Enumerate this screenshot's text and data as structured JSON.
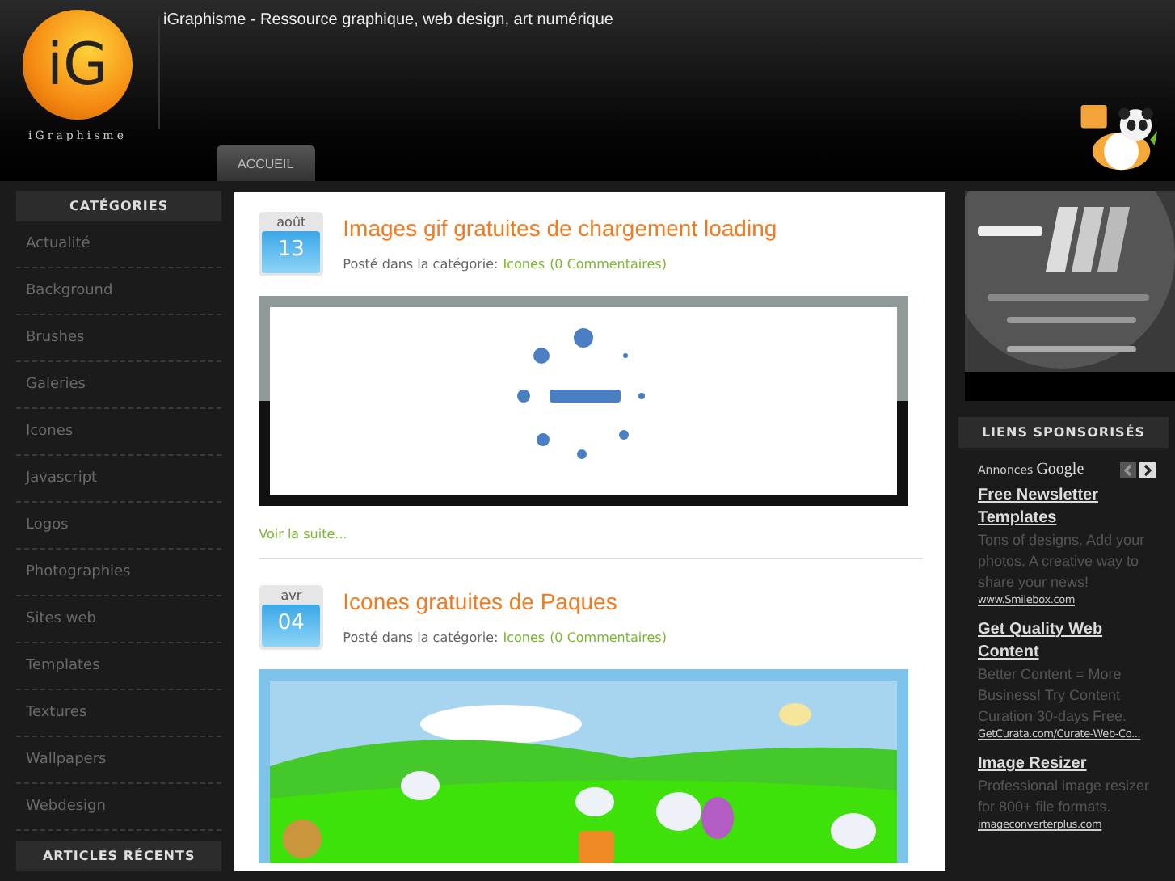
{
  "header": {
    "logo_mark": "iG",
    "logo_name": "iGraphisme",
    "tagline": "iGraphisme - Ressource graphique, web design, art numérique"
  },
  "nav": [
    {
      "label": "ACCUEIL",
      "selected": true
    }
  ],
  "sidebar": {
    "categories_title": "CATÉGORIES",
    "categories": [
      "Actualité",
      "Background",
      "Brushes",
      "Galeries",
      "Icones",
      "Javascript",
      "Logos",
      "Photographies",
      "Sites web",
      "Templates",
      "Textures",
      "Wallpapers",
      "Webdesign"
    ],
    "recent_title": "ARTICLES RÉCENTS"
  },
  "posts": [
    {
      "month": "août",
      "day": "13",
      "title": "Images gif gratuites de chargement loading",
      "meta_prefix": "Posté dans la catégorie:",
      "category": "Icones",
      "comments": "(0 Commentaires)",
      "more": "Voir la suite..."
    },
    {
      "month": "avr",
      "day": "04",
      "title": "Icones gratuites de Paques",
      "meta_prefix": "Posté dans la catégorie:",
      "category": "Icones",
      "comments": "(0 Commentaires)"
    }
  ],
  "sponsored": {
    "title": "LIENS SPONSORISÉS",
    "label": "Annonces",
    "brand": "Google",
    "ads": [
      {
        "title": "Free Newsletter Templates",
        "text": "Tons of designs. Add your photos. A creative way to share your news!",
        "url": "www.Smilebox.com"
      },
      {
        "title": "Get Quality Web Content",
        "text": "Better Content = More Business! Try Content Curation 30-days Free.",
        "url": "GetCurata.com/Curate-Web-Co..."
      },
      {
        "title": "Image Resizer",
        "text": "Professional image resizer for 800+ file formats.",
        "url": "imageconverterplus.com"
      }
    ]
  }
}
